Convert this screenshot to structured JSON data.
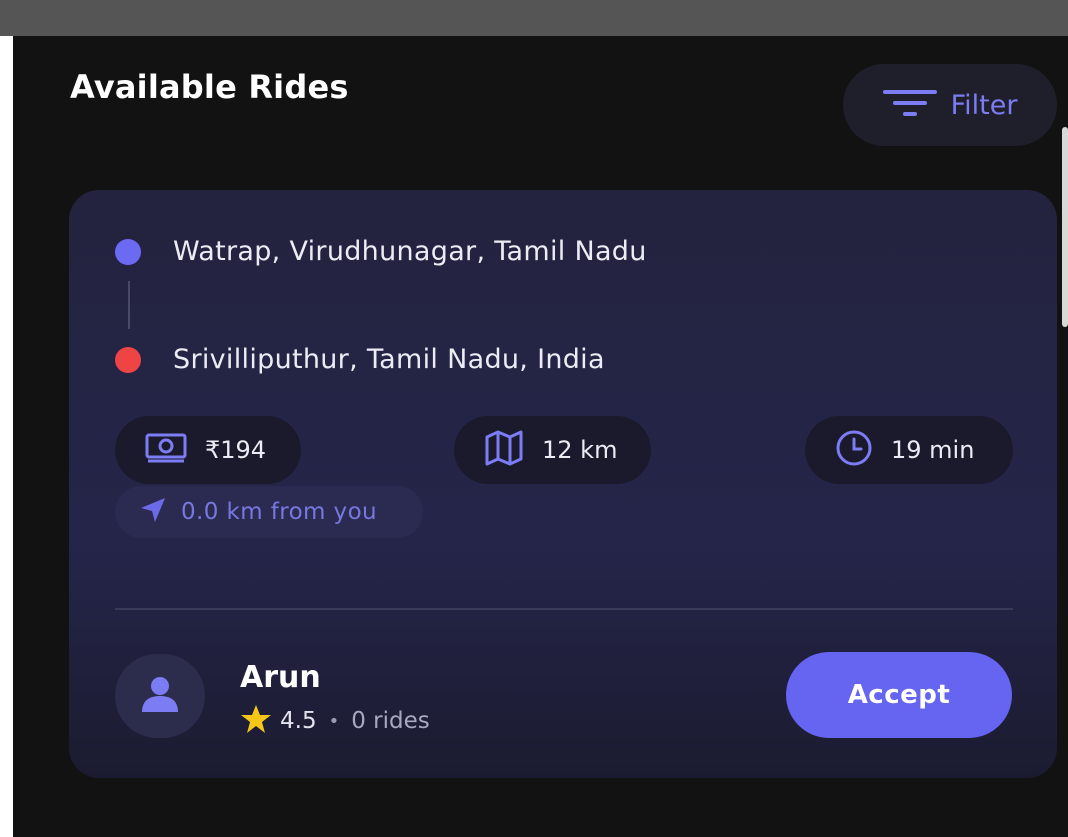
{
  "header": {
    "title": "Available Rides",
    "filter_label": "Filter"
  },
  "ride": {
    "pickup": "Watrap, Virudhunagar, Tamil Nadu",
    "dropoff": "Srivilliputhur, Tamil Nadu, India",
    "fare": "₹194",
    "distance": "12 km",
    "duration": "19 min",
    "proximity": "0.0 km from you",
    "driver": {
      "name": "Arun",
      "rating": "4.5",
      "separator": "•",
      "rides": "0 rides"
    },
    "accept_label": "Accept"
  },
  "colors": {
    "accent": "#6565f2",
    "pickup_dot": "#6a6af2",
    "dropoff_dot": "#ee4444",
    "star": "#f5c518",
    "background": "#121212",
    "card": "#24244a"
  },
  "icons": {
    "filter": "filter-lines-icon",
    "fare": "cash-icon",
    "distance": "map-icon",
    "duration": "clock-icon",
    "proximity": "navigation-arrow-icon",
    "avatar": "user-icon",
    "rating": "star-icon"
  }
}
